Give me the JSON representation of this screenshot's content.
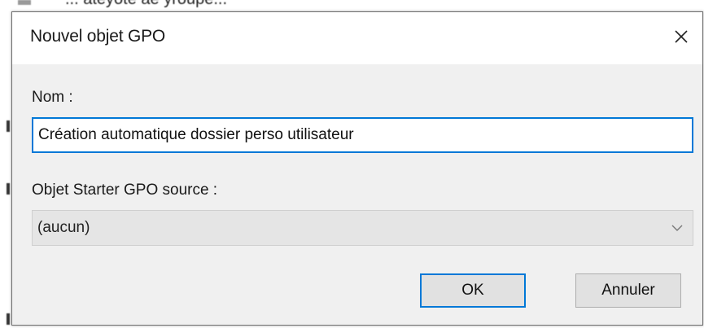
{
  "background": {
    "top_fragment_text": "... ateyote ae yroupe..."
  },
  "dialog": {
    "title": "Nouvel objet GPO",
    "close_icon": "close-icon",
    "name_label": "Nom :",
    "name_value": "Création automatique dossier perso utilisateur",
    "starter_label": "Objet Starter GPO source :",
    "starter_selected": "(aucun)",
    "ok_label": "OK",
    "cancel_label": "Annuler"
  },
  "colors": {
    "accent": "#0078d7",
    "dialog_bg": "#f0f0f0",
    "titlebar_bg": "#ffffff"
  }
}
